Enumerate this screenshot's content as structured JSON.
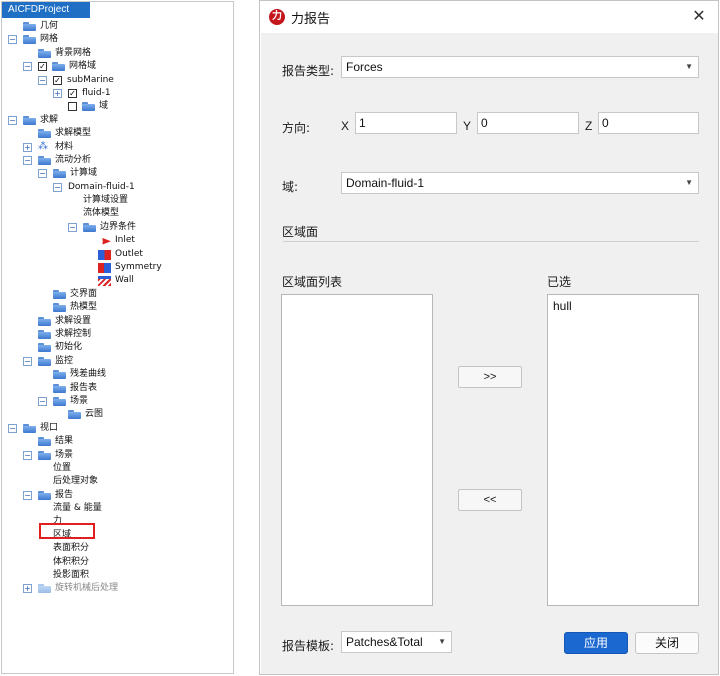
{
  "tree": {
    "tab_label": "AICFDProject",
    "rows": [
      {
        "indent": 0,
        "exp": "",
        "chk": "",
        "icon": "folder",
        "label": "几何"
      },
      {
        "indent": 0,
        "exp": "−",
        "chk": "",
        "icon": "folder",
        "label": "网格"
      },
      {
        "indent": 1,
        "exp": "",
        "chk": "",
        "icon": "folder",
        "label": "背景网格"
      },
      {
        "indent": 1,
        "exp": "−",
        "chk": "✓",
        "icon": "folder",
        "label": "网格域"
      },
      {
        "indent": 2,
        "exp": "−",
        "chk": "✓",
        "icon": "",
        "label": "subMarine"
      },
      {
        "indent": 3,
        "exp": "+",
        "chk": "✓",
        "icon": "",
        "label": "fluid-1"
      },
      {
        "indent": 3,
        "exp": "",
        "chk": "☐",
        "icon": "folder",
        "label": "域"
      },
      {
        "indent": 0,
        "exp": "−",
        "chk": "",
        "icon": "folder",
        "label": "求解"
      },
      {
        "indent": 1,
        "exp": "",
        "chk": "",
        "icon": "folder",
        "label": "求解模型"
      },
      {
        "indent": 1,
        "exp": "+",
        "chk": "",
        "icon": "material",
        "label": "材料"
      },
      {
        "indent": 1,
        "exp": "−",
        "chk": "",
        "icon": "folder",
        "label": "流动分析"
      },
      {
        "indent": 2,
        "exp": "−",
        "chk": "",
        "icon": "folder",
        "label": "计算域"
      },
      {
        "indent": 3,
        "exp": "−",
        "chk": "",
        "icon": "",
        "label": "Domain-fluid-1"
      },
      {
        "indent": 4,
        "exp": "",
        "chk": "",
        "icon": "",
        "label": "计算域设置"
      },
      {
        "indent": 4,
        "exp": "",
        "chk": "",
        "icon": "",
        "label": "流体模型"
      },
      {
        "indent": 4,
        "exp": "−",
        "chk": "",
        "icon": "folder",
        "label": "边界条件"
      },
      {
        "indent": 5,
        "exp": "",
        "chk": "",
        "icon": "inlet",
        "label": "Inlet"
      },
      {
        "indent": 5,
        "exp": "",
        "chk": "",
        "icon": "outlet",
        "label": "Outlet"
      },
      {
        "indent": 5,
        "exp": "",
        "chk": "",
        "icon": "symmetry",
        "label": "Symmetry"
      },
      {
        "indent": 5,
        "exp": "",
        "chk": "",
        "icon": "wall",
        "label": "Wall"
      },
      {
        "indent": 2,
        "exp": "",
        "chk": "",
        "icon": "folder",
        "label": "交界面"
      },
      {
        "indent": 2,
        "exp": "",
        "chk": "",
        "icon": "folder",
        "label": "热模型"
      },
      {
        "indent": 1,
        "exp": "",
        "chk": "",
        "icon": "folder",
        "label": "求解设置"
      },
      {
        "indent": 1,
        "exp": "",
        "chk": "",
        "icon": "folder",
        "label": "求解控制"
      },
      {
        "indent": 1,
        "exp": "",
        "chk": "",
        "icon": "folder",
        "label": "初始化"
      },
      {
        "indent": 1,
        "exp": "−",
        "chk": "",
        "icon": "folder",
        "label": "监控"
      },
      {
        "indent": 2,
        "exp": "",
        "chk": "",
        "icon": "folder",
        "label": "残差曲线"
      },
      {
        "indent": 2,
        "exp": "",
        "chk": "",
        "icon": "folder",
        "label": "报告表"
      },
      {
        "indent": 2,
        "exp": "−",
        "chk": "",
        "icon": "folder",
        "label": "场景"
      },
      {
        "indent": 3,
        "exp": "",
        "chk": "",
        "icon": "folder",
        "label": "云图"
      },
      {
        "indent": 0,
        "exp": "−",
        "chk": "",
        "icon": "folder",
        "label": "视口"
      },
      {
        "indent": 1,
        "exp": "",
        "chk": "",
        "icon": "folder",
        "label": "结果"
      },
      {
        "indent": 1,
        "exp": "−",
        "chk": "",
        "icon": "folder",
        "label": "场景"
      },
      {
        "indent": 2,
        "exp": "",
        "chk": "",
        "icon": "",
        "label": "位置"
      },
      {
        "indent": 2,
        "exp": "",
        "chk": "",
        "icon": "",
        "label": "后处理对象"
      },
      {
        "indent": 1,
        "exp": "−",
        "chk": "",
        "icon": "folder",
        "label": "报告"
      },
      {
        "indent": 2,
        "exp": "",
        "chk": "",
        "icon": "",
        "label": "流量 & 能量"
      },
      {
        "indent": 2,
        "exp": "",
        "chk": "",
        "icon": "",
        "label": "力"
      },
      {
        "indent": 2,
        "exp": "",
        "chk": "",
        "icon": "",
        "label": "区域"
      },
      {
        "indent": 2,
        "exp": "",
        "chk": "",
        "icon": "",
        "label": "表面积分"
      },
      {
        "indent": 2,
        "exp": "",
        "chk": "",
        "icon": "",
        "label": "体积积分"
      },
      {
        "indent": 2,
        "exp": "",
        "chk": "",
        "icon": "",
        "label": "投影面积"
      },
      {
        "indent": 1,
        "exp": "+",
        "chk": "",
        "icon": "folder-gray",
        "label": "旋转机械后处理"
      }
    ]
  },
  "dialog": {
    "title": "力报告",
    "app_icon_glyph": "力",
    "close_glyph": "✕",
    "report_type_label": "报告类型:",
    "report_type_value": "Forces",
    "direction_label": "方向:",
    "x_label": "X",
    "x_value": "1",
    "y_label": "Y",
    "y_value": "0",
    "z_label": "Z",
    "z_value": "0",
    "domain_label": "域:",
    "domain_value": "Domain-fluid-1",
    "zone_surface_section": "区域面",
    "zone_list_label": "区域面列表",
    "selected_label": "已选",
    "selected_items": [
      "hull"
    ],
    "add_button": ">>",
    "remove_button": "<<",
    "template_label": "报告模板:",
    "template_value": "Patches&Total",
    "apply_button": "应用",
    "close_button": "关闭"
  }
}
